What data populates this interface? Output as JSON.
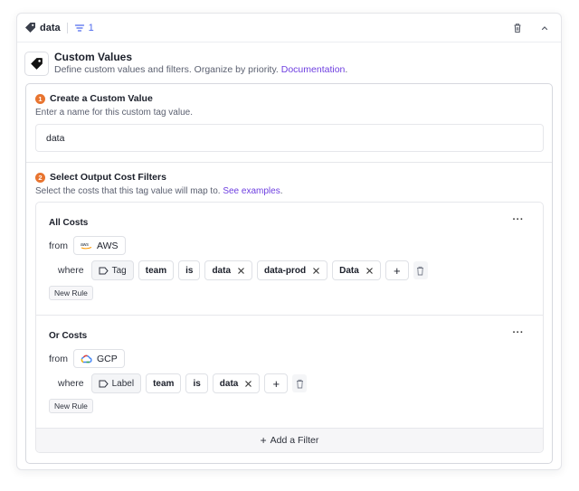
{
  "header": {
    "tag_name": "data",
    "filter_count": "1",
    "icons": [
      "tag-icon",
      "filter-icon",
      "trash-icon",
      "chevron-up-icon"
    ]
  },
  "section": {
    "title": "Custom Values",
    "description": "Define custom values and filters. Organize by priority.",
    "link": "Documentation",
    "link_suffix": "."
  },
  "step1": {
    "number": "1",
    "title": "Create a Custom Value",
    "description": "Enter a name for this custom tag value.",
    "value": "data"
  },
  "step2": {
    "number": "2",
    "title": "Select Output Cost Filters",
    "description": "Select the costs that this tag value will map to.",
    "link": "See examples",
    "link_suffix": "."
  },
  "groups": [
    {
      "title": "All Costs",
      "from_label": "from",
      "source": "AWS",
      "where_label": "where",
      "key_type": "Tag",
      "key": "team",
      "operator": "is",
      "values": [
        "data",
        "data-prod",
        "Data"
      ],
      "new_rule": "New Rule"
    },
    {
      "title": "Or Costs",
      "from_label": "from",
      "source": "GCP",
      "where_label": "where",
      "key_type": "Label",
      "key": "team",
      "operator": "is",
      "values": [
        "data"
      ],
      "new_rule": "New Rule"
    }
  ],
  "add_filter": "Add a Filter",
  "colors": {
    "accent_link": "#6e3fe0",
    "step_badge": "#e8742f",
    "filter_count": "#4f6bed"
  }
}
